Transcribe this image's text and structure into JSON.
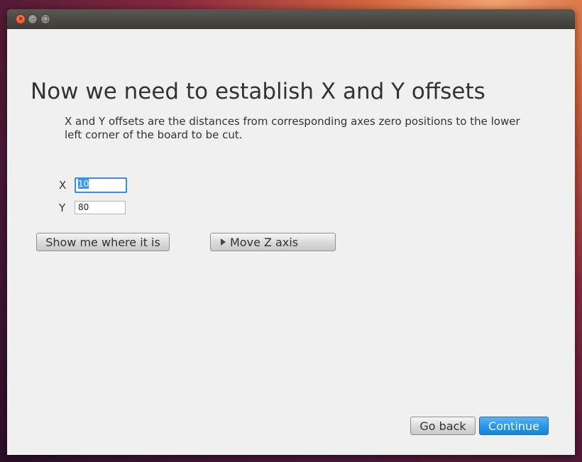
{
  "window": {
    "controls": {
      "close_glyph": "×",
      "minimize_glyph": "–",
      "maximize_glyph": "□"
    }
  },
  "main": {
    "heading": "Now we need to establish X and Y offsets",
    "description": "X and Y offsets are the distances from corresponding axes zero positions to the lower left corner of the board to be cut.",
    "fields": {
      "x": {
        "label": "X",
        "value": "10",
        "selected": true
      },
      "y": {
        "label": "Y",
        "value": "80"
      }
    },
    "buttons": {
      "show_me": "Show me where it is",
      "move_z": "Move Z axis"
    }
  },
  "footer": {
    "go_back": "Go back",
    "continue": "Continue"
  },
  "colors": {
    "accent": "#2a95e8",
    "focus_ring": "#3a8ee0",
    "text": "#333333",
    "panel_bg": "#f0f0f0",
    "titlebar": "#3d3b37",
    "close_button": "#e0481a"
  }
}
